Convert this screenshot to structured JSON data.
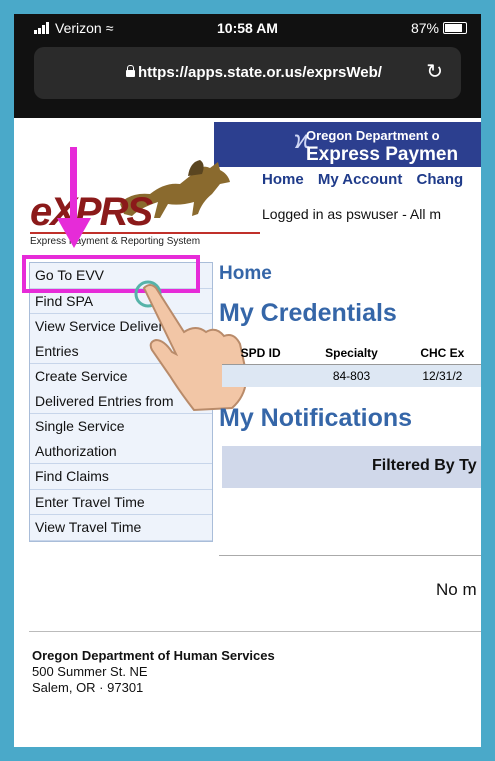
{
  "status": {
    "carrier": "Verizon",
    "time": "10:58 AM",
    "battery": "87%"
  },
  "browser": {
    "url": "https://apps.state.or.us/exprsWeb/"
  },
  "header": {
    "dept_line1": "Oregon Department o",
    "dept_line2": "Express Paymen",
    "logo": "eXPRS",
    "logo_sub": "Express Payment & Reporting System"
  },
  "topnav": [
    "Home",
    "My Account",
    "Chang"
  ],
  "logged_in": "Logged in as pswuser   - All m",
  "sidebar": [
    {
      "label": "Go To EVV",
      "cont": false
    },
    {
      "label": "Find SPA",
      "cont": false
    },
    {
      "label": "View Service Delivered",
      "cont": true
    },
    {
      "label": "Entries",
      "cont": false
    },
    {
      "label": "Create Service",
      "cont": true
    },
    {
      "label": "Delivered Entries from",
      "cont": false
    },
    {
      "label": "Single Service",
      "cont": true
    },
    {
      "label": "Authorization",
      "cont": false
    },
    {
      "label": "Find Claims",
      "cont": false
    },
    {
      "label": "Enter Travel Time",
      "cont": false
    },
    {
      "label": "View Travel Time",
      "cont": false
    }
  ],
  "main": {
    "home": "Home",
    "credentials_title": "My Credentials",
    "cred_headers": [
      "SPD ID",
      "Specialty",
      "CHC Ex"
    ],
    "cred_row": [
      "",
      "84-803",
      "12/31/2"
    ],
    "notifications_title": "My Notifications",
    "filtered_by": "Filtered By Ty",
    "no_text": "No m"
  },
  "footer": {
    "org": "Oregon Department of Human Services",
    "street": "500 Summer St. NE",
    "city": "Salem, OR · 97301"
  },
  "colors": {
    "annotation": "#e62bd8",
    "heading": "#3566a8",
    "frame": "#4aa9c9"
  }
}
